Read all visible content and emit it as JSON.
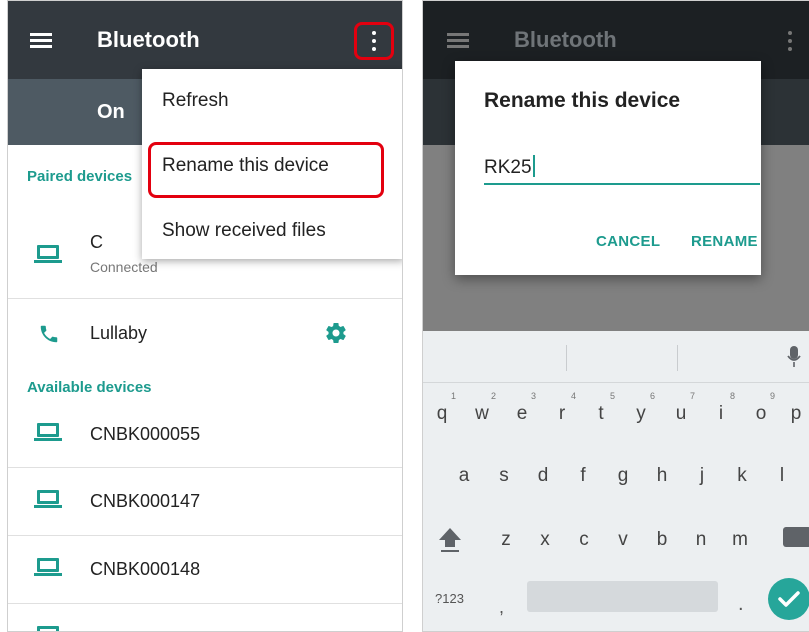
{
  "left": {
    "appbar": {
      "title": "Bluetooth"
    },
    "status": {
      "label": "On"
    },
    "sections": {
      "paired": "Paired devices",
      "available": "Available devices"
    },
    "paired": [
      {
        "name": "C",
        "status": "Connected",
        "icon": "laptop-icon"
      },
      {
        "name": "Lullaby",
        "icon": "phone-icon"
      }
    ],
    "available": [
      {
        "name": "CNBK000055"
      },
      {
        "name": "CNBK000147"
      },
      {
        "name": "CNBK000148"
      }
    ],
    "menu": {
      "refresh": "Refresh",
      "rename": "Rename this device",
      "received": "Show received files"
    }
  },
  "right": {
    "appbar": {
      "title": "Bluetooth"
    },
    "dialog": {
      "title": "Rename this device",
      "value": "RK25",
      "cancel": "CANCEL",
      "confirm": "RENAME"
    },
    "keyboard": {
      "row1": [
        "q",
        "w",
        "e",
        "r",
        "t",
        "y",
        "u",
        "i",
        "o",
        "p"
      ],
      "row1_hints": [
        "1",
        "2",
        "3",
        "4",
        "5",
        "6",
        "7",
        "8",
        "9",
        ""
      ],
      "row2": [
        "a",
        "s",
        "d",
        "f",
        "g",
        "h",
        "j",
        "k",
        "l"
      ],
      "row3": [
        "z",
        "x",
        "c",
        "v",
        "b",
        "n",
        "m"
      ],
      "symbols": "?123",
      "comma": ",",
      "period": "."
    }
  },
  "colors": {
    "accent": "#1d9b8e",
    "highlight": "#e3000f",
    "appbar": "#33393f"
  }
}
